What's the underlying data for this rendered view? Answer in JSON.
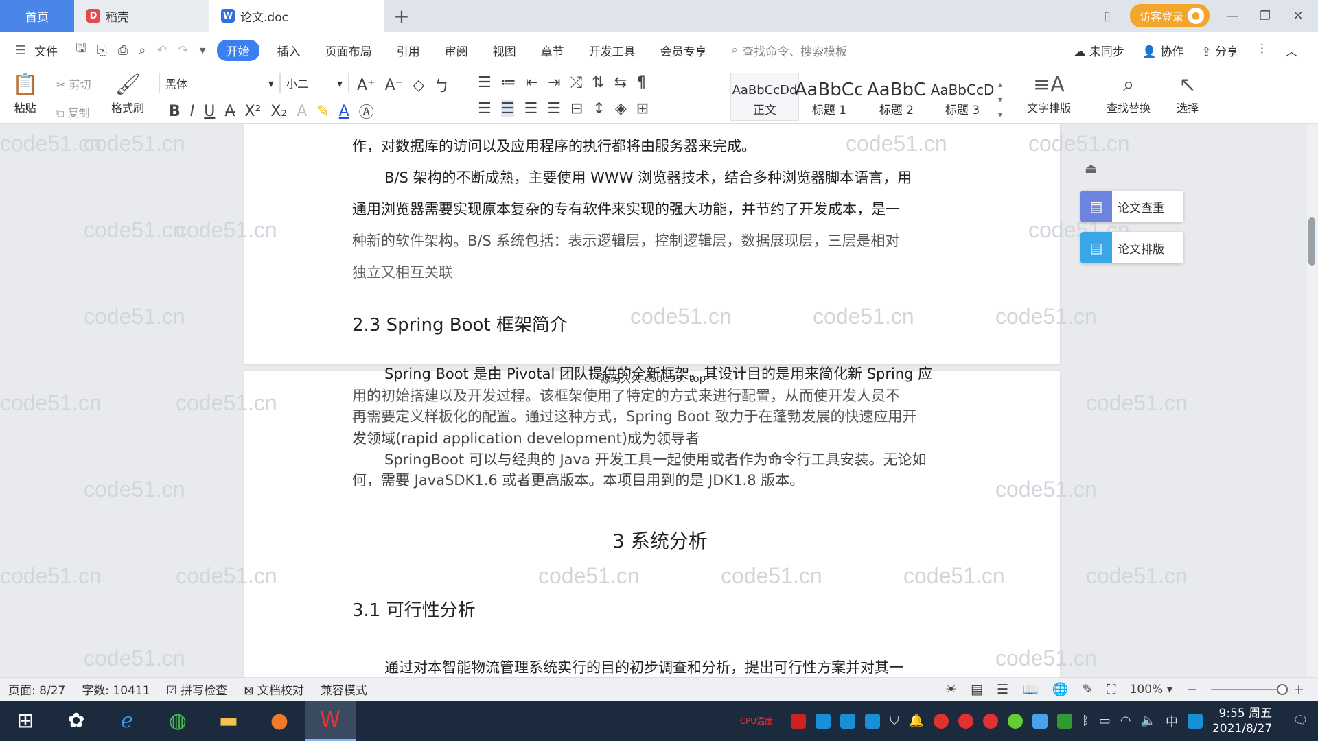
{
  "titlebar": {
    "tabs": [
      {
        "label": "首页"
      },
      {
        "label": "稻壳"
      },
      {
        "label": "论文.doc"
      }
    ],
    "login_label": "访客登录"
  },
  "menubar": {
    "file_label": "文件",
    "items": [
      "开始",
      "插入",
      "页面布局",
      "引用",
      "审阅",
      "视图",
      "章节",
      "开发工具",
      "会员专享"
    ],
    "search_placeholder": "查找命令、搜索模板",
    "right": [
      "未同步",
      "协作",
      "分享"
    ]
  },
  "ribbon": {
    "paste": "粘贴",
    "cut": "剪切",
    "copy": "复制",
    "format_painter": "格式刷",
    "font_name": "黑体",
    "font_size": "小二",
    "styles": [
      {
        "preview": "AaBbCcDd",
        "label": "正文"
      },
      {
        "preview": "AaBbCc",
        "label": "标题 1"
      },
      {
        "preview": "AaBbC",
        "label": "标题 2"
      },
      {
        "preview": "AaBbCcD",
        "label": "标题 3"
      }
    ],
    "text_layout": "文字排版",
    "find_replace": "查找替换",
    "select": "选择"
  },
  "document": {
    "page1_lines": [
      "作，对数据库的访问以及应用程序的执行都将由服务器来完成。",
      "B/S 架构的不断成熟，主要使用 WWW 浏览器技术，结合多种浏览器脚本语言，用",
      "通用浏览器需要实现原本复杂的专有软件来实现的强大功能，并节约了开发成本，是一",
      "种新的软件架构。B/S 系统包括：表示逻辑层，控制逻辑层，数据展现层，三层是相对",
      "独立又相互关联"
    ],
    "heading_2_3": "2.3 Spring Boot 框架简介",
    "page2_lines": [
      "Spring Boot 是由 Pivotal 团队提供的全新框架，其设计目的是用来简化新 Spring 应",
      "用的初始搭建以及开发过程。该框架使用了特定的方式来进行配置，从而使开发人员不",
      "再需要定义样板化的配置。通过这种方式，Spring Boot 致力于在蓬勃发展的快速应用开",
      "发领域(rapid application development)成为领导者",
      "SpringBoot 可以与经典的 Java 开发工具一起使用或者作为命令行工具安装。无论如",
      "何，需要 JavaSDK1.6 或者更高版本。本项目用到的是 JDK1.8 版本。"
    ],
    "overlay_text": "源码久久 code99. top",
    "heading_3": "3 系统分析",
    "heading_3_1": "3.1 可行性分析",
    "last_line": "通过对本智能物流管理系统实行的目的初步调查和分析，提出可行性方案并对其一",
    "watermark": "code51.cn"
  },
  "side_panel": {
    "check": "论文查重",
    "layout": "论文排版"
  },
  "statusbar": {
    "page": "页面: 8/27",
    "words": "字数: 10411",
    "spell": "拼写检查",
    "proof": "文档校对",
    "compat": "兼容模式",
    "zoom": "100%"
  },
  "taskbar": {
    "time": "9:55 周五",
    "date": "2021/8/27",
    "ime": "中",
    "cpu": "CPU温度"
  },
  "colors": {
    "accent": "#3c7ff0",
    "login": "#f4a62a",
    "taskbar": "#1c2a3e"
  }
}
